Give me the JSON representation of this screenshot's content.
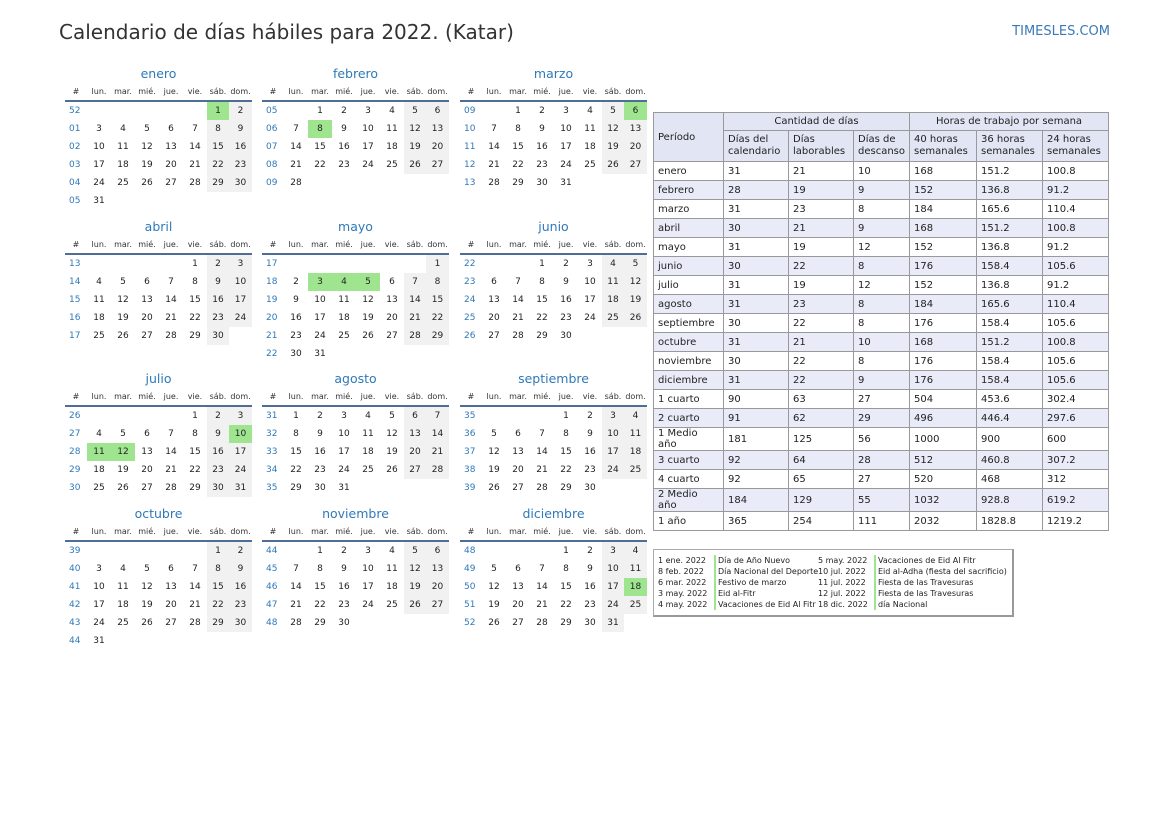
{
  "header": {
    "title": "Calendario de días hábiles para 2022. (Katar)",
    "site": "TIMESLES.COM"
  },
  "colors": {
    "holiday": "#9fe58f",
    "weekend": "#f1f1f1",
    "accent": "#2f79b8",
    "header_line": "#4e6e95"
  },
  "calendar": {
    "weekday_headers": [
      "#",
      "lun.",
      "mar.",
      "mié.",
      "jue.",
      "vie.",
      "sáb.",
      "dom."
    ],
    "months": [
      {
        "name": "enero",
        "offset": 5,
        "days": 31,
        "weeks": [
          "52",
          "01",
          "02",
          "03",
          "04",
          "05"
        ],
        "holidays": [
          1
        ]
      },
      {
        "name": "febrero",
        "offset": 1,
        "days": 28,
        "weeks": [
          "05",
          "06",
          "07",
          "08",
          "09"
        ],
        "holidays": [
          8
        ]
      },
      {
        "name": "marzo",
        "offset": 1,
        "days": 31,
        "weeks": [
          "09",
          "10",
          "11",
          "12",
          "13"
        ],
        "holidays": [
          6
        ]
      },
      {
        "name": "abril",
        "offset": 4,
        "days": 30,
        "weeks": [
          "13",
          "14",
          "15",
          "16",
          "17"
        ],
        "holidays": []
      },
      {
        "name": "mayo",
        "offset": 6,
        "days": 31,
        "weeks": [
          "17",
          "18",
          "19",
          "20",
          "21",
          "22"
        ],
        "holidays": [
          3,
          4,
          5
        ]
      },
      {
        "name": "junio",
        "offset": 2,
        "days": 30,
        "weeks": [
          "22",
          "23",
          "24",
          "25",
          "26"
        ],
        "holidays": []
      },
      {
        "name": "julio",
        "offset": 4,
        "days": 31,
        "weeks": [
          "26",
          "27",
          "28",
          "29",
          "30"
        ],
        "holidays": [
          10,
          11,
          12
        ]
      },
      {
        "name": "agosto",
        "offset": 0,
        "days": 31,
        "weeks": [
          "31",
          "32",
          "33",
          "34",
          "35"
        ],
        "holidays": []
      },
      {
        "name": "septiembre",
        "offset": 3,
        "days": 30,
        "weeks": [
          "35",
          "36",
          "37",
          "38",
          "39"
        ],
        "holidays": []
      },
      {
        "name": "octubre",
        "offset": 5,
        "days": 31,
        "weeks": [
          "39",
          "40",
          "41",
          "42",
          "43",
          "44"
        ],
        "holidays": []
      },
      {
        "name": "noviembre",
        "offset": 1,
        "days": 30,
        "weeks": [
          "44",
          "45",
          "46",
          "47",
          "48"
        ],
        "holidays": []
      },
      {
        "name": "diciembre",
        "offset": 3,
        "days": 31,
        "weeks": [
          "48",
          "49",
          "50",
          "51",
          "52"
        ],
        "holidays": [
          18
        ]
      }
    ]
  },
  "summary": {
    "period_label": "Período",
    "group1": "Cantidad de días",
    "group2": "Horas de trabajo por semana",
    "sub_headers": [
      "Días del calendario",
      "Días laborables",
      "Días de descanso",
      "40 horas semanales",
      "36 horas semanales",
      "24 horas semanales"
    ],
    "rows": [
      [
        "enero",
        "31",
        "21",
        "10",
        "168",
        "151.2",
        "100.8"
      ],
      [
        "febrero",
        "28",
        "19",
        "9",
        "152",
        "136.8",
        "91.2"
      ],
      [
        "marzo",
        "31",
        "23",
        "8",
        "184",
        "165.6",
        "110.4"
      ],
      [
        "abril",
        "30",
        "21",
        "9",
        "168",
        "151.2",
        "100.8"
      ],
      [
        "mayo",
        "31",
        "19",
        "12",
        "152",
        "136.8",
        "91.2"
      ],
      [
        "junio",
        "30",
        "22",
        "8",
        "176",
        "158.4",
        "105.6"
      ],
      [
        "julio",
        "31",
        "19",
        "12",
        "152",
        "136.8",
        "91.2"
      ],
      [
        "agosto",
        "31",
        "23",
        "8",
        "184",
        "165.6",
        "110.4"
      ],
      [
        "septiembre",
        "30",
        "22",
        "8",
        "176",
        "158.4",
        "105.6"
      ],
      [
        "octubre",
        "31",
        "21",
        "10",
        "168",
        "151.2",
        "100.8"
      ],
      [
        "noviembre",
        "30",
        "22",
        "8",
        "176",
        "158.4",
        "105.6"
      ],
      [
        "diciembre",
        "31",
        "22",
        "9",
        "176",
        "158.4",
        "105.6"
      ],
      [
        "1 cuarto",
        "90",
        "63",
        "27",
        "504",
        "453.6",
        "302.4"
      ],
      [
        "2 cuarto",
        "91",
        "62",
        "29",
        "496",
        "446.4",
        "297.6"
      ],
      [
        "1 Medio año",
        "181",
        "125",
        "56",
        "1000",
        "900",
        "600"
      ],
      [
        "3 cuarto",
        "92",
        "64",
        "28",
        "512",
        "460.8",
        "307.2"
      ],
      [
        "4 cuarto",
        "92",
        "65",
        "27",
        "520",
        "468",
        "312"
      ],
      [
        "2 Medio año",
        "184",
        "129",
        "55",
        "1032",
        "928.8",
        "619.2"
      ],
      [
        "1 año",
        "365",
        "254",
        "111",
        "2032",
        "1828.8",
        "1219.2"
      ]
    ]
  },
  "holidays_list": [
    {
      "date": "1 ene. 2022",
      "name": "Día de Año Nuevo"
    },
    {
      "date": "8 feb. 2022",
      "name": "Día Nacional del Deporte"
    },
    {
      "date": "6 mar. 2022",
      "name": "Festivo de marzo"
    },
    {
      "date": "3 may. 2022",
      "name": "Eid al-Fitr"
    },
    {
      "date": "4 may. 2022",
      "name": "Vacaciones de Eid Al Fitr"
    },
    {
      "date": "5 may. 2022",
      "name": "Vacaciones de Eid Al Fitr"
    },
    {
      "date": "10 jul. 2022",
      "name": "Eid al-Adha (fiesta del sacrificio)"
    },
    {
      "date": "11 jul. 2022",
      "name": "Fiesta de las Travesuras"
    },
    {
      "date": "12 jul. 2022",
      "name": "Fiesta de las Travesuras"
    },
    {
      "date": "18 dic. 2022",
      "name": "día Nacional"
    }
  ]
}
